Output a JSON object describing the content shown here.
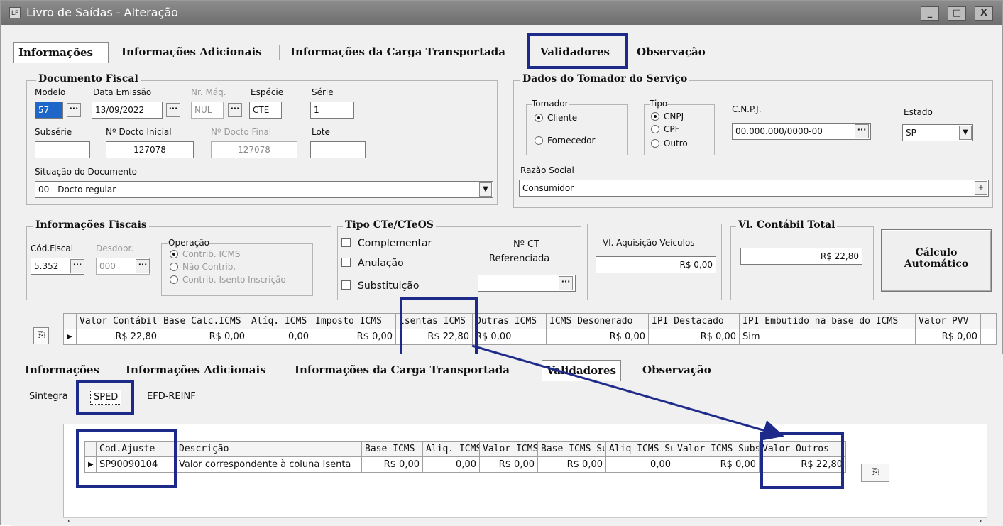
{
  "window": {
    "title": "Livro de Saídas - Alteração",
    "app_icon": "LF",
    "min": "_",
    "max": "□",
    "close": "X"
  },
  "tabs": [
    "Informações",
    "Informações Adicionais",
    "Informações da Carga Transportada",
    "Validadores",
    "Observação"
  ],
  "doc_fiscal": {
    "legend": "Documento Fiscal",
    "modelo_label": "Modelo",
    "modelo": "57",
    "data_emissao_label": "Data Emissão",
    "data_emissao": "13/09/2022",
    "nr_maq_label": "Nr. Máq.",
    "nr_maq": "NUL",
    "especie_label": "Espécie",
    "especie": "CTE",
    "serie_label": "Série",
    "serie": "1",
    "subserie_label": "Subsérie",
    "subserie": "",
    "doc_inicial_label": "Nº Docto Inicial",
    "doc_inicial": "127078",
    "doc_final_label": "Nº Docto Final",
    "doc_final": "127078",
    "lote_label": "Lote",
    "lote": "",
    "situacao_label": "Situação do Documento",
    "situacao": "00 - Docto regular"
  },
  "tomador": {
    "legend": "Dados do Tomador do Serviço",
    "tomador_legend": "Tomador",
    "cliente": "Cliente",
    "fornecedor": "Fornecedor",
    "tipo_legend": "Tipo",
    "cnpj": "CNPJ",
    "cpf": "CPF",
    "outro": "Outro",
    "cnpj_label": "C.N.P.J.",
    "cnpj_value": "00.000.000/0000-00",
    "estado_label": "Estado",
    "estado": "SP",
    "razao_label": "Razão Social",
    "razao": "Consumidor"
  },
  "fiscais": {
    "legend": "Informações Fiscais",
    "cod_label": "Cód.Fiscal",
    "cod": "5.352",
    "desdobr_label": "Desdobr.",
    "desdobr": "000",
    "operacao_legend": "Operação",
    "op1": "Contrib. ICMS",
    "op2": "Não Contrib.",
    "op3": "Contrib. Isento Inscrição"
  },
  "cte": {
    "legend": "Tipo CTe/CTeOS",
    "complementar": "Complementar",
    "anulacao": "Anulação",
    "substituicao": "Substituição",
    "ref_label_1": "Nº CT",
    "ref_label_2": "Referenciada"
  },
  "veiculos": {
    "label": "Vl. Aquisição Veículos",
    "value": "R$ 0,00"
  },
  "contabil": {
    "legend": "Vl. Contábil Total",
    "value": "R$ 22,80"
  },
  "calc_button": {
    "line1": "Cálculo",
    "line2": "Automático"
  },
  "grid1": {
    "headers": [
      "Valor Contábil",
      "Base Calc.ICMS",
      "Alíq. ICMS",
      "Imposto ICMS",
      "Isentas ICMS",
      "Outras ICMS",
      "ICMS Desonerado",
      "IPI Destacado",
      "IPI Embutido na base do ICMS",
      "Valor PVV"
    ],
    "row": [
      "R$ 22,80",
      "R$ 0,00",
      "0,00",
      "R$ 0,00",
      "R$ 22,80",
      "R$ 0,00",
      "R$ 0,00",
      "R$ 0,00",
      "Sim",
      "R$ 0,00"
    ]
  },
  "subtabs": [
    "Sintegra",
    "SPED",
    "EFD-REINF"
  ],
  "grid2": {
    "headers": [
      "Cod.Ajuste",
      "Descrição",
      "Base ICMS",
      "Aliq. ICMS",
      "Valor ICMS",
      "Base ICMS Su",
      "Aliq ICMS Sul",
      "Valor ICMS Subs",
      "Valor Outros"
    ],
    "row": [
      "SP90090104",
      "Valor correspondente à coluna Isenta",
      "R$ 0,00",
      "0,00",
      "R$ 0,00",
      "R$ 0,00",
      "0,00",
      "R$ 0,00",
      "R$ 22,80"
    ]
  },
  "icons": {
    "row_pointer": "triangle-right-icon",
    "doc_icon": "document-edit-icon"
  },
  "colors": {
    "highlight": "#1e2a8a",
    "titlebar": "#7a7a7a"
  }
}
